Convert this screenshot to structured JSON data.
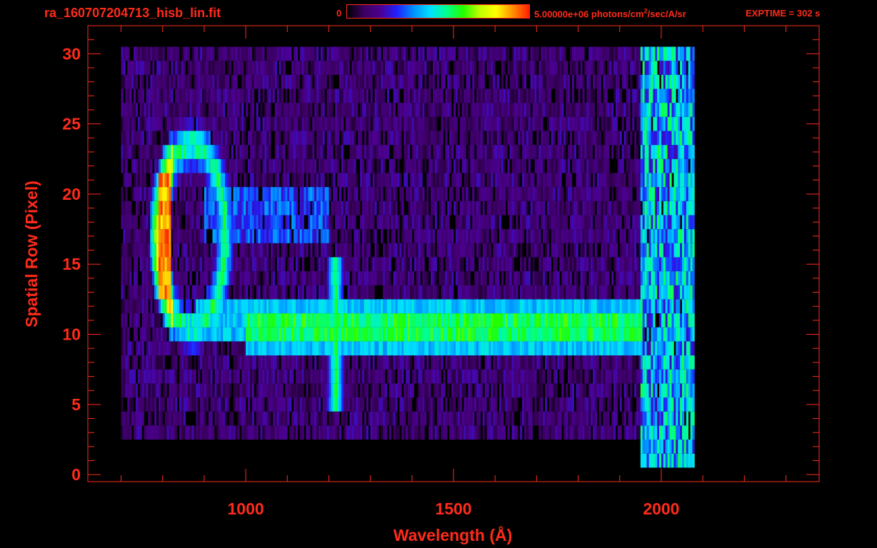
{
  "header": {
    "filename": "ra_160707204713_hisb_lin.fit",
    "colorbar_min": "0",
    "colorbar_max": "5.00000e+06",
    "colorbar_unit_pre": " photons/cm",
    "colorbar_unit_sup": "2",
    "colorbar_unit_post": "/sec/A/sr",
    "exptime": "EXPTIME = 302 s"
  },
  "colors": {
    "axis": "#ff2b1a",
    "background": "#000000",
    "colormap": [
      "#000000",
      "#3a0060",
      "#4b0090",
      "#2020ff",
      "#0090ff",
      "#00e0ff",
      "#00ff90",
      "#20ff00",
      "#c0ff00",
      "#ffff00",
      "#ff9000",
      "#ff2000"
    ]
  },
  "chart_data": {
    "type": "heatmap",
    "title": "ra_160707204713_hisb_lin.fit",
    "xlabel": "Wavelength (Å)",
    "ylabel": "Spatial Row (Pixel)",
    "xlim": [
      620,
      2380
    ],
    "ylim": [
      -0.5,
      32
    ],
    "xticks": [
      1000,
      1500,
      2000
    ],
    "yticks": [
      0,
      5,
      10,
      15,
      20,
      25,
      30
    ],
    "x_minor_step": 100,
    "y_minor_step": 1,
    "zlim": [
      0,
      5000000
    ],
    "features": [
      {
        "name": "background",
        "x_range": [
          700,
          2080
        ],
        "rows": [
          3,
          30
        ],
        "level": 0.12
      },
      {
        "name": "continuum",
        "x_range": [
          1000,
          1950
        ],
        "rows": [
          9,
          12
        ],
        "level": 0.52
      },
      {
        "name": "emission-line",
        "x_center": 1216,
        "rows": [
          5,
          15
        ],
        "level": 0.6
      },
      {
        "name": "ring",
        "x_center": 870,
        "y_center": 17,
        "x_radius": 80,
        "y_radius": 6.5,
        "level": 0.6
      },
      {
        "name": "bright-left-edge",
        "x_range": [
          790,
          820
        ],
        "rows": [
          13,
          21
        ],
        "level": 0.95
      },
      {
        "name": "upper-band",
        "x_range": [
          900,
          1200
        ],
        "rows": [
          17,
          20
        ],
        "level": 0.3
      },
      {
        "name": "red-edge",
        "x_range": [
          1950,
          2080
        ],
        "rows": [
          1,
          30
        ],
        "level": 0.4
      }
    ]
  }
}
